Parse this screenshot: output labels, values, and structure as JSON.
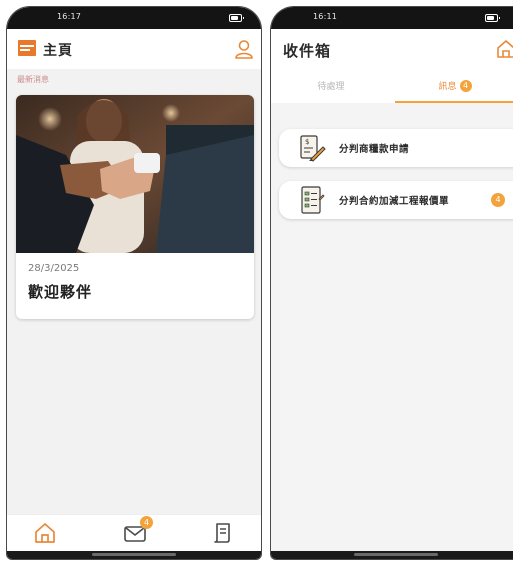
{
  "left_screen": {
    "status_time": "16:17",
    "header": {
      "title": "主頁",
      "logo_icon": "company-logo",
      "profile_icon": "user-profile-icon"
    },
    "news_section_label": "最新消息",
    "news_item": {
      "date": "28/3/2025",
      "title": "歡迎夥伴",
      "image": "handshake-photo"
    },
    "tab_bar": {
      "items": [
        {
          "icon": "home-icon"
        },
        {
          "icon": "mail-icon",
          "badge": "4"
        },
        {
          "icon": "document-icon"
        }
      ]
    }
  },
  "right_screen": {
    "status_time": "16:11",
    "header": {
      "title": "收件箱",
      "home_icon": "home-icon"
    },
    "tabs": [
      {
        "label": "待處理",
        "active": false
      },
      {
        "label": "訊息",
        "badge": "4",
        "active": true
      }
    ],
    "messages": [
      {
        "icon": "payment-application-icon",
        "label": "分判商糧款申請"
      },
      {
        "icon": "checklist-icon",
        "label": "分判合約加減工程報價單",
        "badge": "4"
      }
    ]
  },
  "colors": {
    "accent": "#f3a33a",
    "brand": "#e8782c",
    "status_bar": "#141414"
  }
}
